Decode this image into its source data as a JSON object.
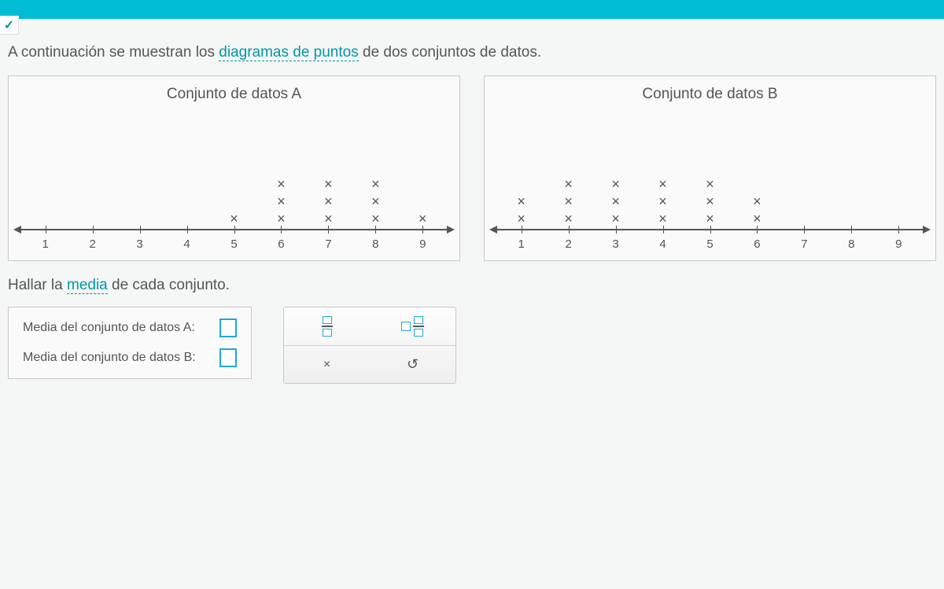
{
  "prompt_pre": "A continuación se muestran los ",
  "prompt_link": "diagramas de puntos",
  "prompt_post": " de dos conjuntos de datos.",
  "question_pre": "Hallar la ",
  "question_link": "media",
  "question_post": " de cada conjunto.",
  "answers": {
    "label_a": "Media del conjunto de datos A:",
    "label_b": "Media del conjunto de datos B:"
  },
  "toolbox": {
    "clear_label": "×",
    "reset_label": "↺"
  },
  "chart_data": [
    {
      "type": "dotplot",
      "title": "Conjunto de datos A",
      "xlabel": "",
      "xlim": [
        1,
        9
      ],
      "ticks": [
        1,
        2,
        3,
        4,
        5,
        6,
        7,
        8,
        9
      ],
      "counts": {
        "1": 0,
        "2": 0,
        "3": 0,
        "4": 0,
        "5": 1,
        "6": 3,
        "7": 3,
        "8": 3,
        "9": 1
      }
    },
    {
      "type": "dotplot",
      "title": "Conjunto de datos B",
      "xlabel": "",
      "xlim": [
        1,
        9
      ],
      "ticks": [
        1,
        2,
        3,
        4,
        5,
        6,
        7,
        8,
        9
      ],
      "counts": {
        "1": 2,
        "2": 3,
        "3": 3,
        "4": 3,
        "5": 3,
        "6": 2,
        "7": 0,
        "8": 0,
        "9": 0
      }
    }
  ]
}
